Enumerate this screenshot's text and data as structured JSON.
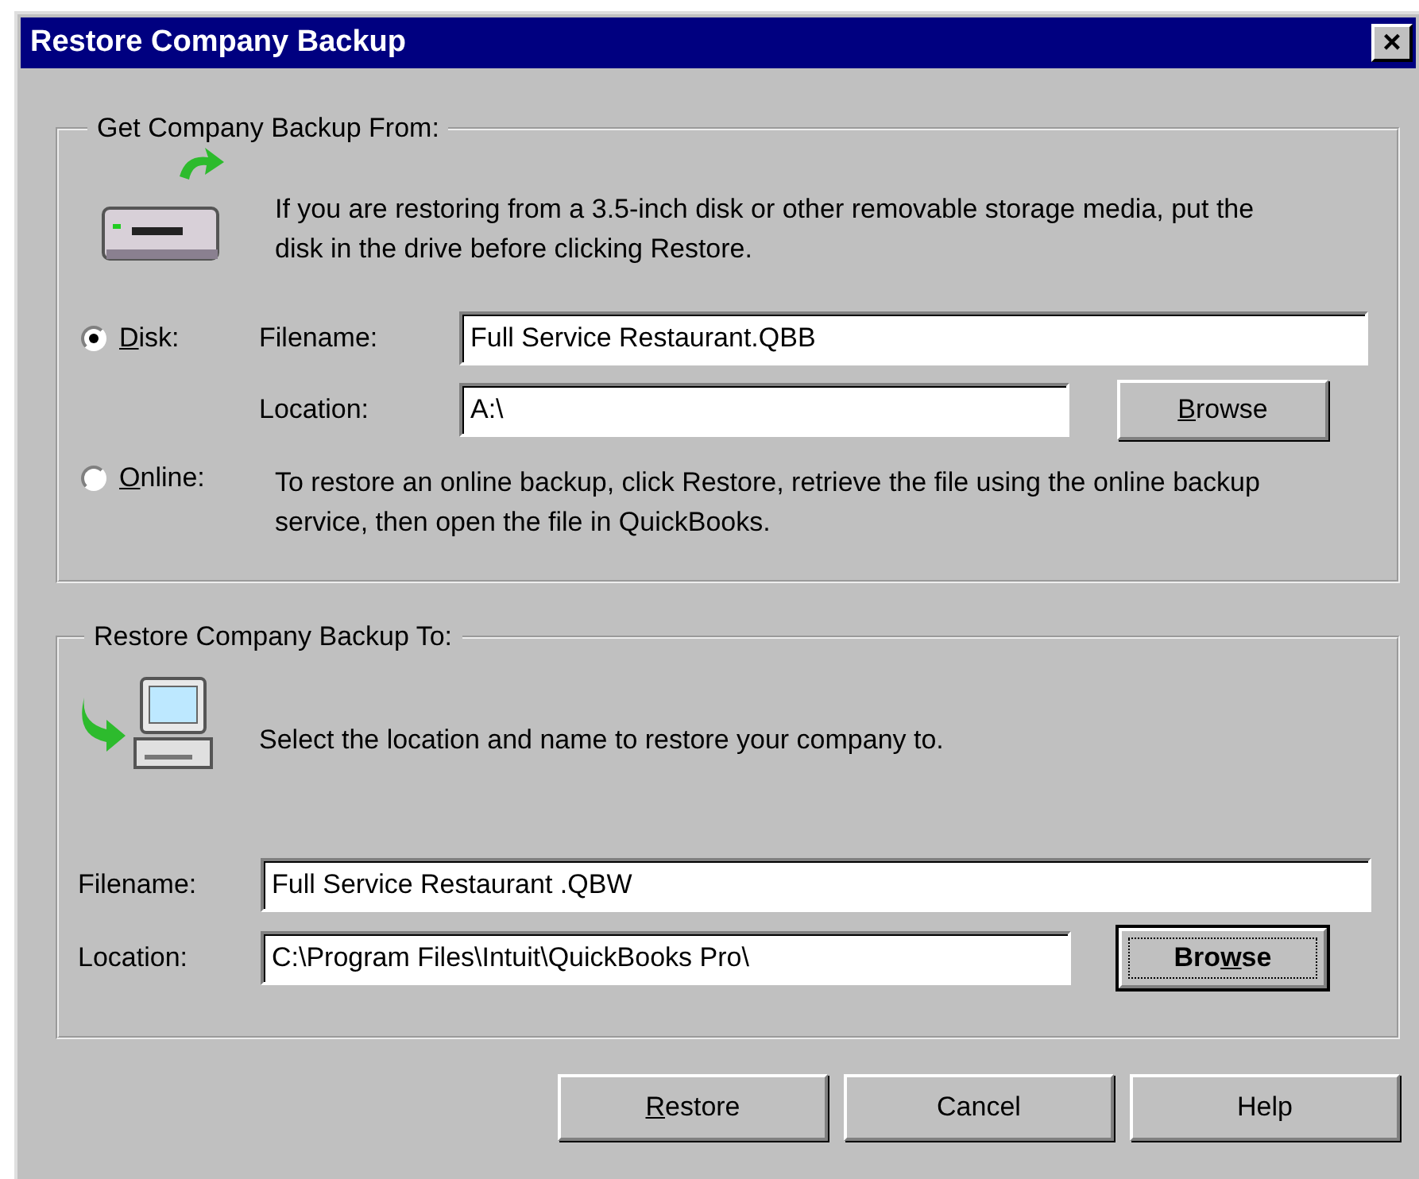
{
  "window": {
    "title": "Restore Company Backup",
    "close_label": "×"
  },
  "source": {
    "legend": "Get Company Backup From:",
    "info": "If you are restoring from a 3.5-inch disk or other removable storage media, put the disk in the drive before clicking Restore.",
    "options": [
      {
        "kind": "disk",
        "label_parts": [
          {
            "text": "D",
            "underlined": true
          },
          {
            "text": "isk:",
            "underlined": false
          }
        ],
        "selected": true
      },
      {
        "kind": "online",
        "label_parts": [
          {
            "text": "O",
            "underlined": true
          },
          {
            "text": "nline:",
            "underlined": false
          }
        ],
        "selected": false,
        "description": "To restore an online backup, click Restore, retrieve the file using the online backup service, then open the file in QuickBooks."
      }
    ],
    "filename": {
      "label": "Filename:",
      "value": "Full Service Restaurant.QBB"
    },
    "location": {
      "label": "Location:",
      "value": "A:\\"
    },
    "browse": {
      "label_parts": [
        {
          "text": "B",
          "underlined": true
        },
        {
          "text": "rowse",
          "underlined": false
        }
      ],
      "focused": false
    }
  },
  "destination": {
    "legend": "Restore Company Backup To:",
    "info": "Select the location and name to restore your company to.",
    "filename": {
      "label": "Filename:",
      "value": "Full Service Restaurant .QBW"
    },
    "location": {
      "label": "Location:",
      "value": "C:\\Program Files\\Intuit\\QuickBooks Pro\\"
    },
    "browse": {
      "label_parts": [
        {
          "text": "Bro",
          "underlined": false
        },
        {
          "text": "w",
          "underlined": true
        },
        {
          "text": "se",
          "underlined": false
        }
      ],
      "focused": true
    }
  },
  "buttons": [
    {
      "label_parts": [
        {
          "text": "R",
          "underlined": true
        },
        {
          "text": "estore",
          "underlined": false
        }
      ],
      "focused": false
    },
    {
      "label_parts": [
        {
          "text": "Cancel",
          "underlined": false
        }
      ],
      "focused": false
    },
    {
      "label_parts": [
        {
          "text": "Help",
          "underlined": false
        }
      ],
      "focused": false
    }
  ]
}
